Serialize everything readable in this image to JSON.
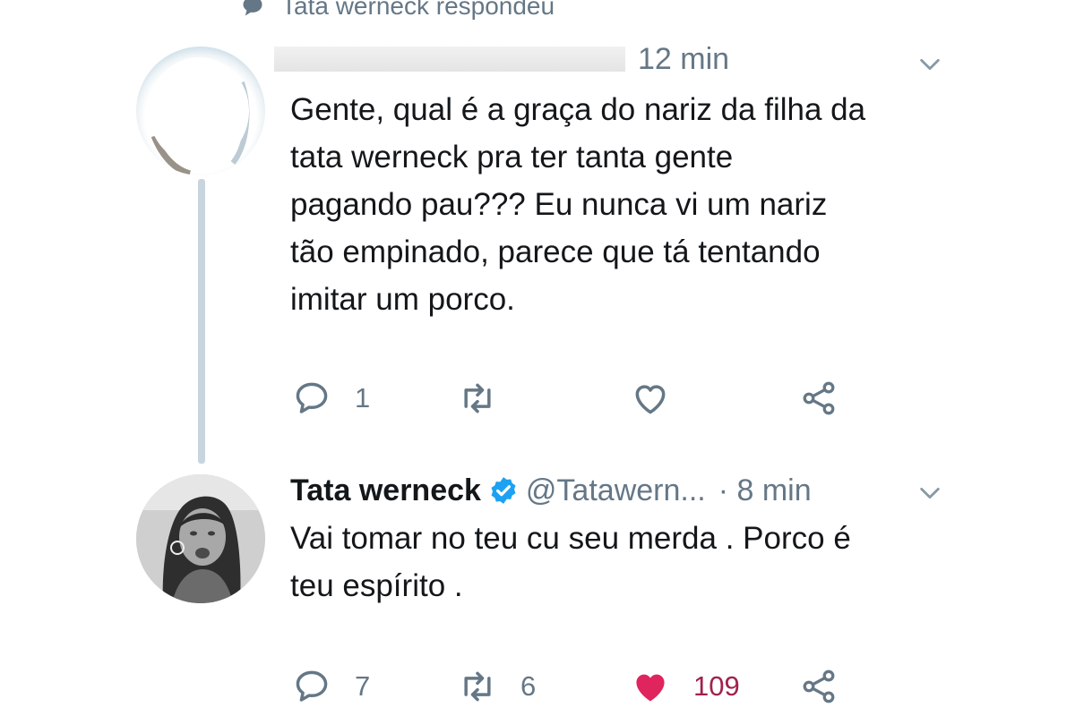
{
  "context": {
    "icon": "speech-bubble-icon",
    "text": "Tata werneck respondeu"
  },
  "tweets": [
    {
      "avatar": "redacted-avatar",
      "display_name_redacted": true,
      "time": "12 min",
      "text_lines": [
        "Gente, qual é a graça do nariz da filha da",
        "tata werneck pra ter tanta gente",
        "pagando pau??? Eu nunca vi um nariz",
        "tão empinado, parece que tá tentando",
        "imitar um porco."
      ],
      "actions": {
        "reply_count": "1",
        "retweet_count": "",
        "like_count": "",
        "liked": false
      }
    },
    {
      "avatar": "tata-werneck-avatar",
      "display_name": "Tata werneck",
      "verified": true,
      "handle": "@Tatawern...",
      "time": "· 8 min",
      "text_lines": [
        "Vai tomar no teu cu seu merda . Porco é",
        "teu espírito ."
      ],
      "actions": {
        "reply_count": "7",
        "retweet_count": "6",
        "like_count": "109",
        "liked": true
      }
    }
  ],
  "colors": {
    "text_primary": "#14171a",
    "text_secondary": "#657786",
    "verified_blue": "#1da1f2",
    "like_red": "#e0245e",
    "thread_line": "#c9d5de"
  }
}
